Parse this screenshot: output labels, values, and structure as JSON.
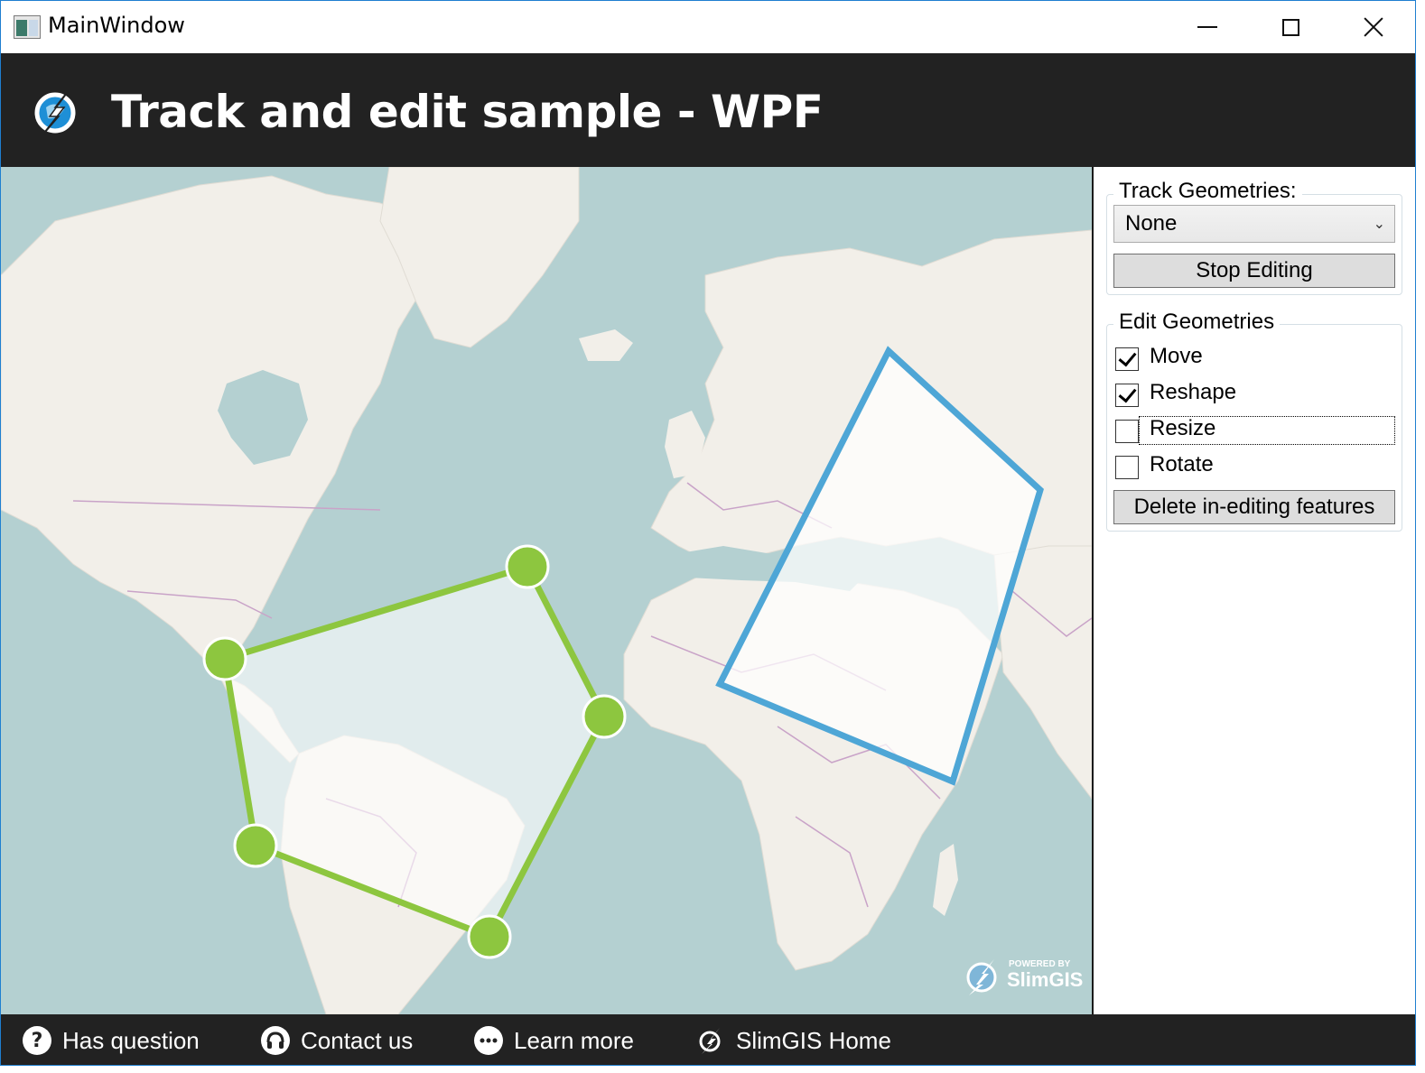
{
  "window": {
    "title": "MainWindow",
    "controls": [
      "minimize",
      "maximize",
      "close"
    ]
  },
  "header": {
    "logo_icon": "slimgis-logo-icon",
    "title": "Track and edit sample - WPF"
  },
  "map": {
    "attribution_small": "POWERED BY",
    "attribution_brand": "SlimGIS",
    "colors": {
      "water": "#b4d0d1",
      "land": "#f2efe9",
      "border": "#c9a3c8",
      "polygon_stroke_green": "#8dc63f",
      "polygon_stroke_blue": "#4ea6d6"
    }
  },
  "side_panel": {
    "track_group": {
      "legend": "Track Geometries:",
      "select_value": "None",
      "stop_button": "Stop Editing"
    },
    "edit_group": {
      "legend": "Edit Geometries",
      "options": [
        {
          "label": "Move",
          "checked": true
        },
        {
          "label": "Reshape",
          "checked": true
        },
        {
          "label": "Resize",
          "checked": false
        },
        {
          "label": "Rotate",
          "checked": false
        }
      ],
      "delete_button": "Delete in-editing features"
    }
  },
  "footer": {
    "items": [
      {
        "label": "Has question",
        "icon": "question-icon"
      },
      {
        "label": "Contact us",
        "icon": "headset-icon"
      },
      {
        "label": "Learn more",
        "icon": "chat-bubble-icon"
      },
      {
        "label": "SlimGIS Home",
        "icon": "slimgis-logo-icon"
      }
    ]
  }
}
